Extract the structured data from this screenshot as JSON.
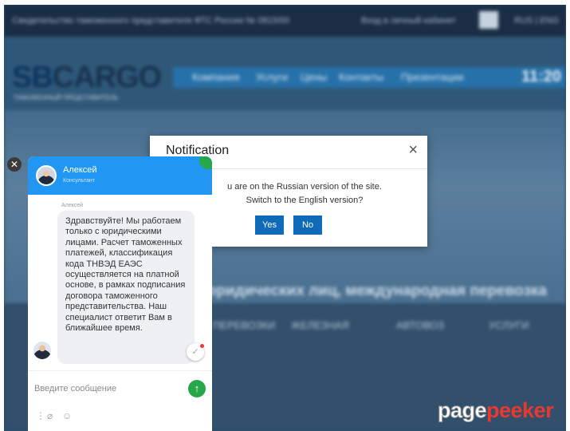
{
  "site": {
    "topbar_text": "Свидетельство таможенного представителя ФТС России № 0815/00",
    "login_text": "Вход в личный кабинет",
    "lang_text": "RUS | ENG",
    "logo_sb": "SB",
    "logo_cargo": "CARGO",
    "logo_sub": "ТАМОЖЕННЫЙ ПРЕДСТАВИТЕЛЬ",
    "nav": [
      "Компания",
      "Услуги",
      "Цены",
      "Контакты",
      "Презентации"
    ],
    "time": "11:20",
    "hero_text": "юридических лиц, международная перевозка",
    "categories": [
      "ПЕРЕВОЗКИ",
      "ЖЕЛЕЗНАЯ",
      "АВТОВОЗ",
      "УСЛУГИ"
    ]
  },
  "modal": {
    "title": "Notification",
    "close_glyph": "×",
    "message_line1": "u are on the Russian version of the site.",
    "message_line2": "Switch to the English version?",
    "yes_label": "Yes",
    "no_label": "No"
  },
  "chat": {
    "close_glyph": "✕",
    "agent_name": "Алексей",
    "agent_role": "Консультант",
    "message_author": "Алексей",
    "message": "Здравствуйте! Мы работаем только с юридическими лицами. Расчет таможенных платежей, классификация кода ТНВЭД ЕАЭС осуществляется на платной основе, в рамках подписания договора таможенного представительства. Наш специалист ответит Вам в ближайшее время.",
    "check_glyph": "✓",
    "input_placeholder": "Введите сообщение",
    "send_glyph": "↑",
    "tool_more_glyph": "⋮",
    "tool_attach_glyph": "⌀",
    "tool_emoji_glyph": "☺",
    "header_color": "#2196f3",
    "send_color": "#27a74a"
  },
  "watermark": {
    "page": "page",
    "peeker": "peeker"
  }
}
